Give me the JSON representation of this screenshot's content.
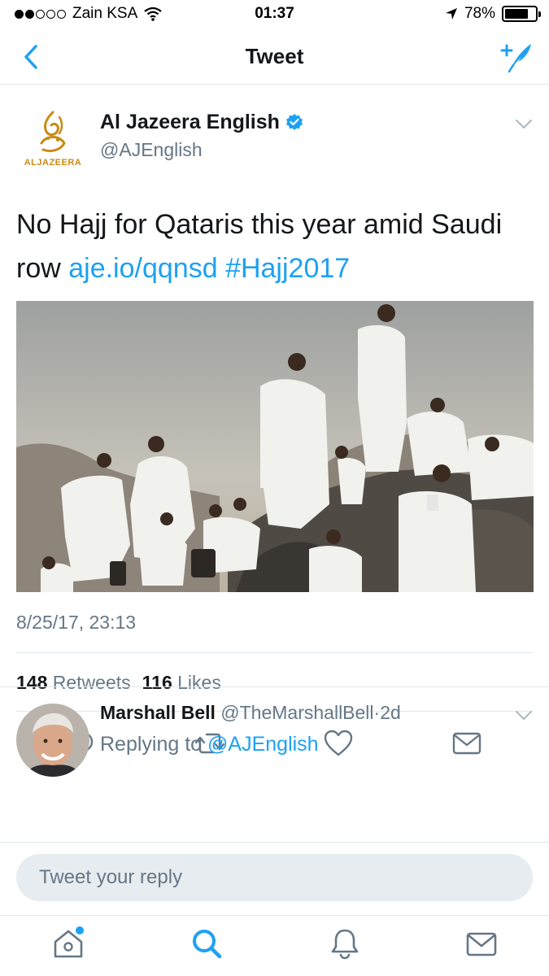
{
  "status": {
    "carrier": "Zain KSA",
    "time": "01:37",
    "battery_percent": "78%",
    "battery_level": 0.78
  },
  "nav": {
    "title": "Tweet"
  },
  "tweet": {
    "author": {
      "name": "Al Jazeera English",
      "handle": "@AJEnglish",
      "logo_text": "ALJAZEERA",
      "verified": true
    },
    "text": "No Hajj for Qataris this year amid Saudi row ",
    "link": "aje.io/qqnsd",
    "hashtag": "#Hajj2017",
    "timestamp": "8/25/17, 23:13",
    "retweets": "148",
    "retweets_label": "Retweets",
    "likes": "116",
    "likes_label": "Likes"
  },
  "reply": {
    "name": "Marshall Bell",
    "handle": "@TheMarshallBell",
    "separator": "·",
    "age": "2d",
    "replying_prefix": "Replying to",
    "replying_to": "@AJEnglish"
  },
  "composer": {
    "placeholder": "Tweet your reply"
  },
  "colors": {
    "accent": "#1da1f2",
    "secondary_text": "#657786",
    "aljazeera_gold": "#c98a14"
  },
  "icons": [
    "back-chevron-icon",
    "compose-tweet-icon",
    "verified-badge-icon",
    "caret-down-icon",
    "reply-icon",
    "retweet-icon",
    "like-icon",
    "direct-message-icon",
    "home-icon",
    "search-icon",
    "notifications-icon",
    "messages-icon"
  ]
}
